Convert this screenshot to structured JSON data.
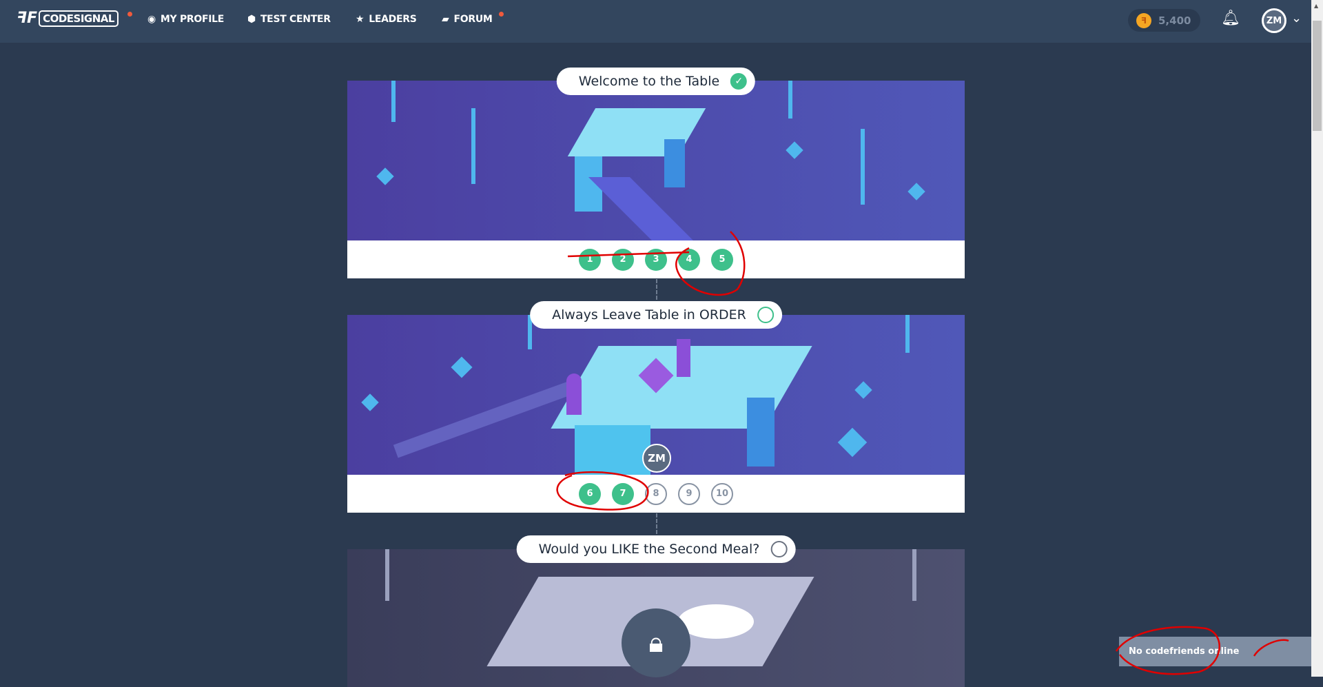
{
  "nav": {
    "logo_text": "CODESIGNAL",
    "items": [
      {
        "label": "MY PROFILE",
        "icon": "user-circle-icon"
      },
      {
        "label": "TEST CENTER",
        "icon": "shield-icon"
      },
      {
        "label": "LEADERS",
        "icon": "star-icon"
      },
      {
        "label": "FORUM",
        "icon": "chat-icon"
      }
    ],
    "coins": "5,400",
    "avatar": "ZM",
    "notification_color": "#f05a3c"
  },
  "chapters": [
    {
      "title": "Welcome to the Table",
      "status": "completed",
      "levels": [
        "1",
        "2",
        "3",
        "4",
        "5"
      ],
      "completed": 5
    },
    {
      "title": "Always Leave Table in ORDER",
      "status": "in-progress",
      "levels": [
        "6",
        "7",
        "8",
        "9",
        "10"
      ],
      "completed": 2,
      "current_marker": "ZM"
    },
    {
      "title": "Would you LIKE the Second Meal?",
      "status": "locked"
    }
  ],
  "chat": {
    "status": "No codefriends online"
  },
  "colors": {
    "accent": "#3ec08b",
    "background": "#2b3a50",
    "navbar": "#33465e",
    "annotation": "#e00000"
  }
}
